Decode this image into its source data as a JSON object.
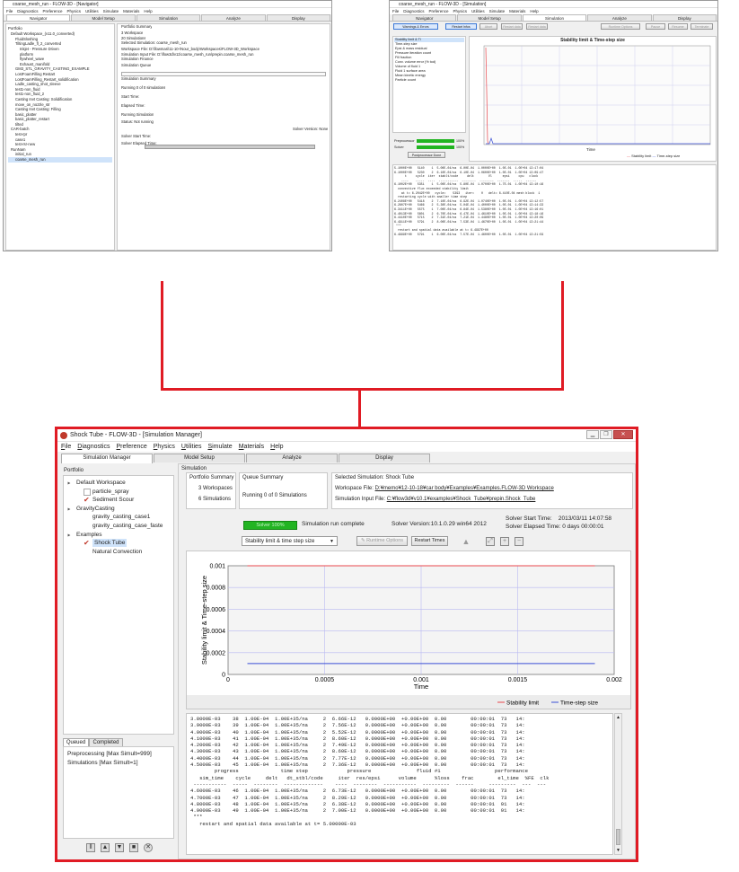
{
  "top_left": {
    "title": "coarse_mesh_run - FLOW-3D - [Navigator]",
    "menu": [
      "File",
      "Diagnostics",
      "Preference",
      "Physics",
      "Utilities",
      "Simulate",
      "Materials",
      "Help"
    ],
    "tabs": [
      "Navigator",
      "Model Setup",
      "Simulation",
      "Analyze",
      "Display"
    ],
    "portfolio_label": "Portfolio",
    "tree": [
      "Default Workspace_(v11.0_converted)",
      "FluidSloshing",
      "TiltingLadle_fl_2_converted",
      "Inkjet - Pressure Driven",
      "platform",
      "flywheel_wave",
      "Exhaust_manifold",
      "GM3_STL_GRAVITY_CASTING_EXAMPLE",
      "LostFoamFilling Restart",
      "LostFoamFilling_Restart_solidification",
      "Ladle_casting_shot_sleeve",
      "test1-non_fluid",
      "test1-non_fluid_2",
      "Casting Invt Casting: Solidification",
      "move_on_nozzle_str",
      "Casting Invt Casting: Filling",
      "basic_platter",
      "basic_platter_restart",
      "tilted",
      "CAR-batch",
      "test-rpr",
      "case1",
      "test-rsr-new",
      "RunNam",
      "initial_run",
      "coarse_mesh_run"
    ],
    "summary": [
      "Portfolio Summary",
      "3 Workspace",
      "20 Simulations"
    ],
    "selected": [
      "Selected Simulation: coarse_mesh_run",
      "Workspace File: D:\\flowmari\\11-10-\\Nour_body\\Workspaces\\FLOW-3D_Workspace",
      "Simulation Input File: D:\\flow3d\\v11\\coarse_mesh_run\\prepin.coarse_mesh_run"
    ],
    "finance": [
      "Simulation Finance",
      "Simulation Queue"
    ],
    "run": [
      "Simulation Summary",
      "Running 0 of 0 simulations",
      "Start Time:",
      "Elapsed Time:"
    ],
    "running": [
      "Running Simulation",
      "Status: Not running",
      "Solver Version: None",
      "Solver Start Time:",
      "Solver Elapsed Time:"
    ]
  },
  "top_right": {
    "title": "coarse_mesh_run - FLOW-3D - [Simulation]",
    "menu": [
      "File",
      "Diagnostics",
      "Preference",
      "Physics",
      "Utilities",
      "Simulate",
      "Materials",
      "Help"
    ],
    "tabs": [
      "Navigator",
      "Model Setup",
      "Simulation",
      "Analyze",
      "Display"
    ],
    "buttons": [
      "Warnings & Errors",
      "Restart Infos",
      "Abort",
      "Restart data",
      "Restart data",
      "Runtime Options",
      "Pause",
      "Resume",
      "Terminate"
    ],
    "list": [
      "Stability limit & Ti",
      "Time-step size",
      "Epsi & mass residual",
      "Pressure iteration count",
      "Fill fraction",
      "Conv. volume error (% tod)",
      "Volume of fluid 1",
      "Fluid 1 surface area",
      "Mean kinetic energy",
      "Particle count"
    ],
    "progress": [
      "Preprocessor",
      "Solver",
      "100%",
      "100%",
      "Postprocessor Done"
    ],
    "chart_title": "Stability limit & Time-step size",
    "xlabel": "Time",
    "legend": [
      "Stability limit",
      "Time-step size"
    ],
    "log": [
      "5.1000E+00   5140    1  5.00E-04/na  6.00E-04  1.0000E+00  1.0E-01  1.0E+04 13:17:04",
      "6.1000E+00   5230    2  6.10E-04/na  6.10E-04  1.0600E+00  1.0E-01  1.0E+04 13:09:47",
      "",
      "      t     cycle  iter  stablt/code     delt        Vl      epsi     cpu   clock",
      "    ----    -----  ----  -----------  --------  --------  -------  -----  ------",
      "6.1002E+00   5351    1  5.00E-04/na  5.80E-04  1.0700E+00  1.7E-01  1.0E+04 13:10:16",
      "  convective flux exceeded stability limit",
      "    at t= 6.2042E+00   cycle=    5393   iter=    0   delt= 6.410E-04 mesh block  1",
      "  restarting cycle with smaller time step",
      "6.2408E+00   5418    2  7.10E-04/na  6.92E-04  1.0740E+00  1.0E-01  1.0E+04 13:12:57",
      "6.2807E+00   5466    2  5.30E-04/na  5.04E-04  1.4000E+00  1.0E-01  1.0E+04 13:14:33",
      "6.3411E+00   5575    1  7.00E-04/na  6.84E-04  1.5380E+00  1.0E-01  1.0E+04 13:16:01",
      "6.4013E+00   5601    2  6.70E-04/na  6.47E-04  1.4610E+00  1.0E-01  1.0E+04 13:18:16",
      "6.4410E+00   5715    2  7.31E-04/na  7.21E-04  1.4480E+00  1.0E-01  1.0E+04 13:20:09",
      "6.4911E+00   5791    2  8.00E-04/na  7.53E-04  1.4670E+00  1.0E-01  1.0E+04 13:21:44",
      " ***",
      "  restart and spatial data available at t= 6.4997E+00",
      "",
      "6.4999E+00   5791    1  6.00E-04/na  7.57E-04  1.4600E+00  1.0E-01  1.0E+04 13:21:59"
    ]
  },
  "main": {
    "title": "Shock Tube - FLOW-3D - [Simulation Manager]",
    "menu": [
      "File",
      "Diagnostics",
      "Preference",
      "Physics",
      "Utilities",
      "Simulate",
      "Materials",
      "Help"
    ],
    "tabs": [
      "Simulation Manager",
      "Model Setup",
      "Analyze",
      "Display"
    ],
    "portfolio_label": "Portfolio",
    "simulation_label": "Simulation",
    "tree": [
      {
        "label": "Default Workspace",
        "level": 0,
        "expander": "▲"
      },
      {
        "label": "particle_spray",
        "level": 2
      },
      {
        "label": "Sediment Scour",
        "level": 2
      },
      {
        "label": "GravityCasting",
        "level": 0,
        "expander": "▲"
      },
      {
        "label": "gravity_casting_case1",
        "level": 2
      },
      {
        "label": "gravity_casting_case_faste",
        "level": 2
      },
      {
        "label": "Examples",
        "level": 0,
        "expander": "▲"
      },
      {
        "label": "Shock Tube",
        "level": 2
      },
      {
        "label": "Natural Convection",
        "level": 2
      }
    ],
    "queue_tabs": [
      "Queued",
      "Completed"
    ],
    "queue_items": [
      "Preprocessing [Max Simult=999]",
      "Simulations [Max Simult=1]"
    ],
    "portfolio_summary": {
      "title": "Portfolio Summary",
      "workspaces": "3 Workspaces",
      "simulations": "6 Simulations"
    },
    "queue_summary": {
      "title": "Queue Summary",
      "running": "Running   0   of   0   Simulations"
    },
    "selected": {
      "title": "Selected Simulation: Shock Tube",
      "workspace_label": "Workspace File:",
      "workspace_value": "D:¥memo¥12-10-18¥car body¥Examples¥Examples.FLOW-3D Workspace",
      "input_label": "Simulation Input File:",
      "input_value": "C:¥flow3d¥v10.1¥examples¥Shock_Tube¥prepin.Shock_Tube"
    },
    "status": {
      "solver_badge": "Solver 100%",
      "message": "Simulation run complete",
      "solver_version": "Solver Version:10.1.0.29 win64 2012",
      "start_label": "Solver Start Time:",
      "start_value": "2013/03/11 14:07:58",
      "elapsed_label": "Solver Elapsed Time:",
      "elapsed_value": "0 days 00:00:01"
    },
    "dropdown": "Stability limit & time step size",
    "runtime_options": "Runtime Options",
    "restart_times": "Restart Times",
    "log_lines": [
      "3.8000E-03    38  1.00E-04  1.00E+35/na     2  6.66E-12   0.0000E+00  +0.00E+00  0.00        00:00:01  73   14:",
      "3.9000E-03    39  1.00E-04  1.00E+35/na     2  7.56E-12   0.0000E+00  +0.00E+00  0.00        00:00:01  73   14:",
      "4.0000E-03    40  1.00E-04  1.00E+35/na     2  5.52E-12   0.0000E+00  +0.00E+00  0.00        00:00:01  73   14:",
      "4.1000E-03    41  1.00E-04  1.00E+35/na     2  8.60E-12   0.0000E+00  +0.00E+00  0.00        00:00:01  73   14:",
      "4.2000E-03    42  1.00E-04  1.00E+35/na     2  7.49E-12   0.0000E+00  +0.00E+00  0.00        00:00:01  73   14:",
      "4.3000E-03    43  1.00E-04  1.00E+35/na     2  8.60E-12   0.0000E+00  +0.00E+00  0.00        00:00:01  73   14:",
      "4.4000E-03    44  1.00E-04  1.00E+35/na     2  7.77E-12   0.0000E+00  +0.00E+00  0.00        00:00:01  73   14:",
      "4.5000E-03    45  1.00E-04  1.00E+35/na     2  7.36E-12   0.0000E+00  +0.00E+00  0.00        00:00:01  73   14:",
      "",
      "        progress              time step             pressure               fluid #1                  performance",
      "   sim_time    cycle     delt   dt_stbl/code     iter  res/epsi      volume      %loss    frac        el_time  %FE  clk",
      " -----------  -----  --------  -------------    ----  --------  -----------  ---------  ------     ---------  ---  ---",
      "4.6000E-03    46  1.00E-04  1.00E+35/na     2  6.73E-12   0.0000E+00  +0.00E+00  0.00        00:00:01  73   14:",
      "4.7000E-03    47  1.00E-04  1.00E+35/na     2  8.29E-12   0.0000E+00  +0.00E+00  0.00        00:00:01  73   14:",
      "4.8000E-03    48  1.00E-04  1.00E+35/na     2  6.38E-12   0.0000E+00  +0.00E+00  0.00        00:00:01  91   14:",
      "4.9000E-03    49  1.00E-04  1.00E+35/na     2  7.00E-12   0.0000E+00  +0.00E+00  0.00        00:00:01  91   14:",
      " ***",
      "   restart and spatial data available at t= 5.00000E-03"
    ]
  },
  "chart_data": {
    "type": "line",
    "title": "",
    "xlabel": "Time",
    "ylabel": "Stability limit & Time-step size",
    "xlim": [
      0,
      0.002
    ],
    "ylim": [
      0,
      0.001
    ],
    "x_ticks": [
      "0",
      "0.0005",
      "0.001",
      "0.0015",
      "0.002"
    ],
    "y_ticks": [
      "0",
      "0.0002",
      "0.0004",
      "0.0006",
      "0.0008",
      "0.001"
    ],
    "grid": true,
    "legend": "bottom-right",
    "series": [
      {
        "name": "Stability limit",
        "color": "#e8474c",
        "x": [
          0.0001,
          0.0019
        ],
        "y": [
          0.001,
          0.001
        ]
      },
      {
        "name": "Time-step size",
        "color": "#3a4fd6",
        "x": [
          0.0001,
          0.0019
        ],
        "y": [
          0.0001,
          0.0001
        ]
      }
    ]
  },
  "colors": {
    "accent": "#e01b24",
    "progress": "#22b422",
    "stability": "#e8474c",
    "timestep": "#3a4fd6"
  }
}
